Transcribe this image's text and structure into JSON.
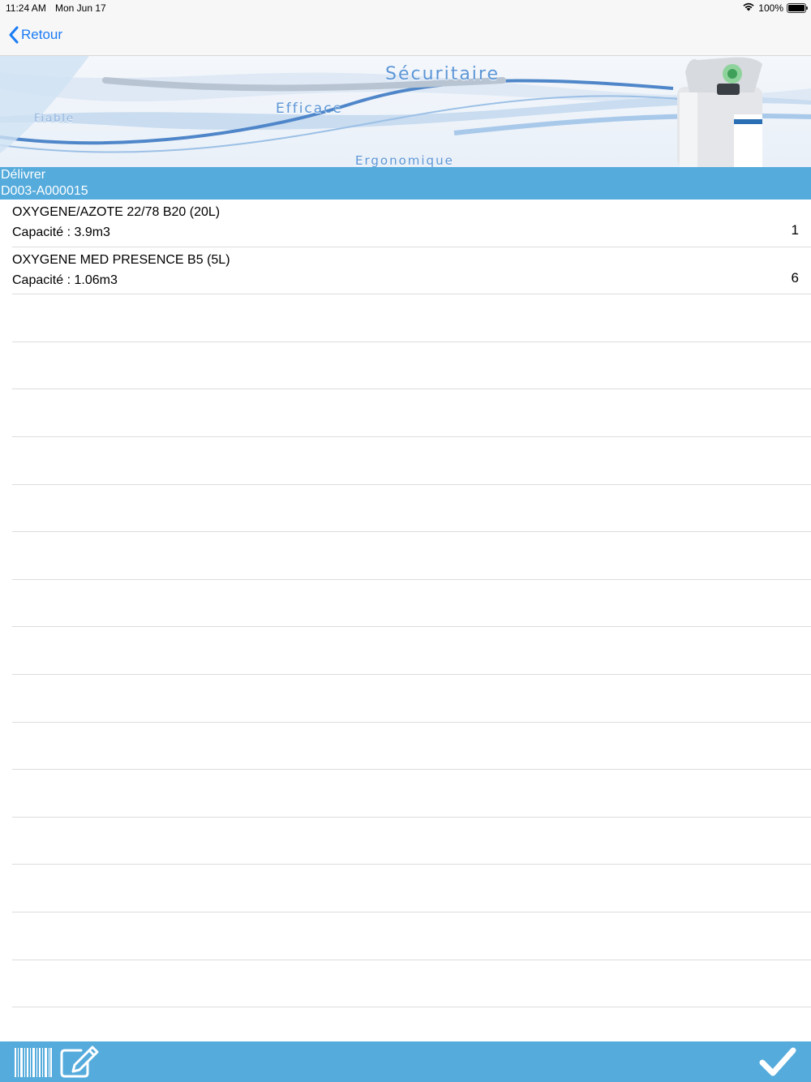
{
  "status_bar": {
    "time": "11:24 AM",
    "date": "Mon Jun 17",
    "battery": "100%",
    "battery_level": 1.0
  },
  "nav": {
    "back_label": "Retour"
  },
  "banner": {
    "word_securitaire": "Sécuritaire",
    "word_efficace": "Efficace",
    "word_fiable": "Fiable",
    "word_ergonomique": "Ergonomique"
  },
  "section": {
    "title": "Délivrer",
    "code": "D003-A000015"
  },
  "items": [
    {
      "title": "OXYGENE/AZOTE 22/78 B20 (20L)",
      "subtitle": "Capacité : 3.9m3",
      "quantity": "1"
    },
    {
      "title": "OXYGENE MED PRESENCE B5 (5L)",
      "subtitle": "Capacité : 1.06m3",
      "quantity": "6"
    }
  ],
  "colors": {
    "accent": "#55abdc",
    "link": "#1a7cf5"
  }
}
